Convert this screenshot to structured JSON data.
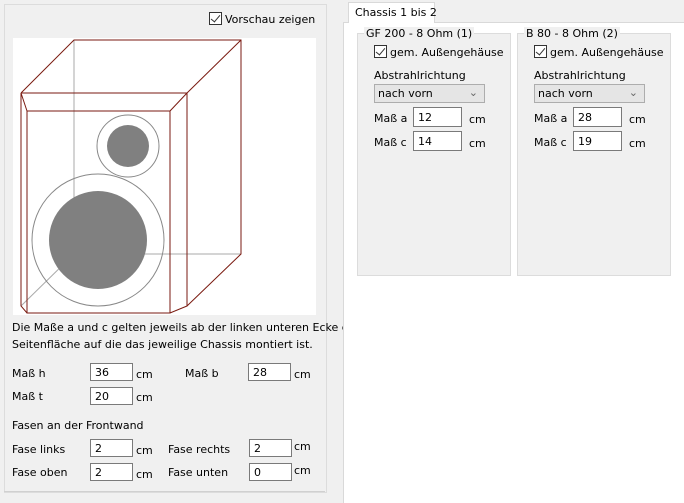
{
  "preview": {
    "show_label": "Vorschau zeigen",
    "checked": true
  },
  "description": [
    "Die Maße a und c gelten jeweils ab der linken unteren Ecke der",
    "Seitenfläche auf die das jeweilige Chassis montiert ist."
  ],
  "dims": {
    "h_label": "Maß h",
    "h": "36",
    "b_label": "Maß b",
    "b": "28",
    "t_label": "Maß t",
    "t": "20",
    "unit": "cm"
  },
  "fasen": {
    "heading": "Fasen an der Frontwand",
    "links_label": "Fase links",
    "links": "2",
    "rechts_label": "Fase rechts",
    "rechts": "2",
    "oben_label": "Fase oben",
    "oben": "2",
    "unten_label": "Fase unten",
    "unten": "0"
  },
  "tab": {
    "label": "Chassis 1 bis 2"
  },
  "chassis": [
    {
      "title": "GF 200 - 8 Ohm (1)",
      "check_label": "gem. Außengehäuse",
      "checked": true,
      "dir_label": "Abstrahlrichtung",
      "dir_value": "nach vorn",
      "a_label": "Maß a",
      "a": "12",
      "c_label": "Maß c",
      "c": "14",
      "unit": "cm"
    },
    {
      "title": "B 80 - 8 Ohm (2)",
      "check_label": "gem. Außengehäuse",
      "checked": true,
      "dir_label": "Abstrahlrichtung",
      "dir_value": "nach vorn",
      "a_label": "Maß a",
      "a": "28",
      "c_label": "Maß c",
      "c": "19",
      "unit": "cm"
    }
  ],
  "colors": {
    "edge": "#7a1a10",
    "driver": "#808080"
  }
}
